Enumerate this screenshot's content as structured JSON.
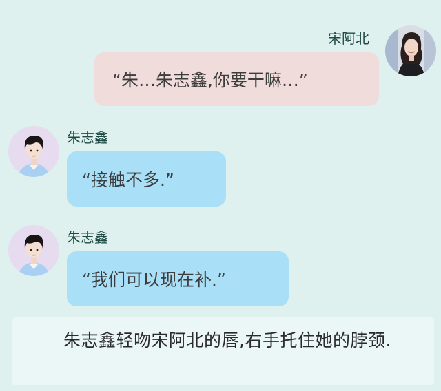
{
  "messages": [
    {
      "speaker": "宋阿北",
      "text": "“朱…朱志鑫,你要干嘛…”",
      "side": "right",
      "bubble_color": "#f1dcdc",
      "avatar_icon": "female-portrait-avatar"
    },
    {
      "speaker": "朱志鑫",
      "text": "“接触不多.”",
      "side": "left",
      "bubble_color": "#a9e0f7",
      "avatar_icon": "male-portrait-avatar"
    },
    {
      "speaker": "朱志鑫",
      "text": "“我们可以现在补.”",
      "side": "left",
      "bubble_color": "#a9e0f7",
      "avatar_icon": "male-portrait-avatar"
    }
  ],
  "narration": {
    "text": "朱志鑫轻吻宋阿北的唇,右手托住她的脖颈."
  },
  "colors": {
    "background": "#dff1ee",
    "narration_bg": "#eaf7f6",
    "name_text": "#1f4a46"
  }
}
